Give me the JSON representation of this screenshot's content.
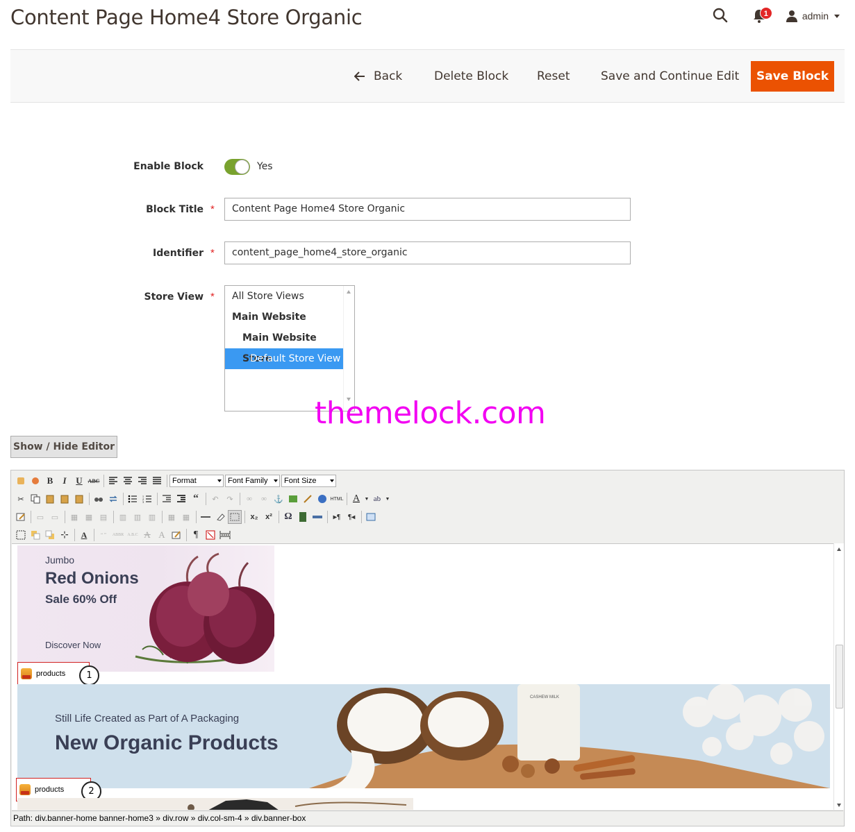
{
  "header": {
    "title": "Content Page Home4 Store Organic",
    "notifications_count": "1",
    "user": "admin"
  },
  "actions": {
    "back": "Back",
    "delete": "Delete Block",
    "reset": "Reset",
    "save_continue": "Save and Continue Edit",
    "save": "Save Block"
  },
  "form": {
    "enable_label": "Enable Block",
    "enable_value": "Yes",
    "title_label": "Block Title",
    "title_value": "Content Page Home4 Store Organic",
    "identifier_label": "Identifier",
    "identifier_value": "content_page_home4_store_organic",
    "store_label": "Store View",
    "store_options": [
      "All Store Views",
      "Main Website",
      "Main Website Store",
      "Default Store View"
    ],
    "store_selected": "Default Store View"
  },
  "watermark": "themelock.com",
  "editor": {
    "toggle_label": "Show / Hide Editor",
    "format_select": "Format",
    "font_family_select": "Font Family",
    "font_size_select": "Font Size",
    "banner1": {
      "small": "Jumbo",
      "title": "Red Onions",
      "sale": "Sale 60% Off",
      "link": "Discover Now"
    },
    "banner2": {
      "small": "Still Life Created as Part of A Packaging",
      "title": "New Organic Products",
      "product_label": "CASHEW MILK"
    },
    "widget1": "products",
    "widget2": "products",
    "callout1": "1",
    "callout2": "2",
    "path": "Path: div.banner-home banner-home3 » div.row » div.col-sm-4 » div.banner-box"
  },
  "colors": {
    "primary_button": "#eb5202",
    "toggle_on": "#79a22e",
    "selected_option": "#3a99f2",
    "watermark": "#f200f2"
  }
}
